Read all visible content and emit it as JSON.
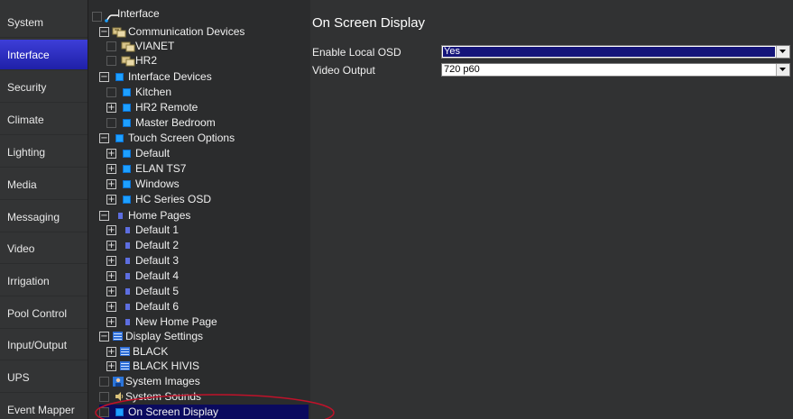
{
  "nav": {
    "items": [
      {
        "label": "System"
      },
      {
        "label": "Interface",
        "active": true
      },
      {
        "label": "Security"
      },
      {
        "label": "Climate"
      },
      {
        "label": "Lighting"
      },
      {
        "label": "Media"
      },
      {
        "label": "Messaging"
      },
      {
        "label": "Video"
      },
      {
        "label": "Irrigation"
      },
      {
        "label": "Pool Control"
      },
      {
        "label": "Input/Output"
      },
      {
        "label": "UPS"
      },
      {
        "label": "Event Mapper"
      }
    ]
  },
  "tree": {
    "items": [
      {
        "label": "Interface",
        "icon": "interface-wire-icon"
      },
      {
        "label": "Communication Devices",
        "icon": "network-device-icon"
      },
      {
        "label": "VIANET",
        "icon": "network-device-icon"
      },
      {
        "label": "HR2",
        "icon": "network-device-icon"
      },
      {
        "label": "Interface Devices",
        "icon": "blue-square-icon"
      },
      {
        "label": "Kitchen",
        "icon": "blue-square-icon"
      },
      {
        "label": "HR2 Remote",
        "icon": "blue-square-icon"
      },
      {
        "label": "Master Bedroom",
        "icon": "blue-square-icon"
      },
      {
        "label": "Touch Screen Options",
        "icon": "blue-square-icon"
      },
      {
        "label": "Default",
        "icon": "blue-square-icon"
      },
      {
        "label": "ELAN TS7",
        "icon": "blue-square-icon"
      },
      {
        "label": "Windows",
        "icon": "blue-square-icon"
      },
      {
        "label": "HC Series OSD",
        "icon": "blue-square-icon"
      },
      {
        "label": "Home Pages",
        "icon": "page-icon"
      },
      {
        "label": "Default 1",
        "icon": "page-icon"
      },
      {
        "label": "Default 2",
        "icon": "page-icon"
      },
      {
        "label": "Default 3",
        "icon": "page-icon"
      },
      {
        "label": "Default 4",
        "icon": "page-icon"
      },
      {
        "label": "Default 5",
        "icon": "page-icon"
      },
      {
        "label": "Default 6",
        "icon": "page-icon"
      },
      {
        "label": "New Home Page",
        "icon": "page-icon"
      },
      {
        "label": "Display Settings",
        "icon": "display-settings-icon"
      },
      {
        "label": "BLACK",
        "icon": "display-settings-icon"
      },
      {
        "label": "BLACK HIVIS",
        "icon": "display-settings-icon"
      },
      {
        "label": "System Images",
        "icon": "image-icon"
      },
      {
        "label": "System Sounds",
        "icon": "speaker-icon"
      },
      {
        "label": "On Screen Display",
        "icon": "blue-square-icon",
        "selected": true
      }
    ]
  },
  "content": {
    "title": "On Screen Display",
    "fields": [
      {
        "label": "Enable Local OSD",
        "value": "Yes"
      },
      {
        "label": "Video Output",
        "value": "720 p60"
      }
    ]
  },
  "colors": {
    "nav_bg": "#333435",
    "nav_active": "#2a2bc4",
    "tree_bg": "#2b2c2d",
    "content_bg": "#313233",
    "selected_row": "#0a0a5e",
    "annotation": "#c0122a"
  }
}
